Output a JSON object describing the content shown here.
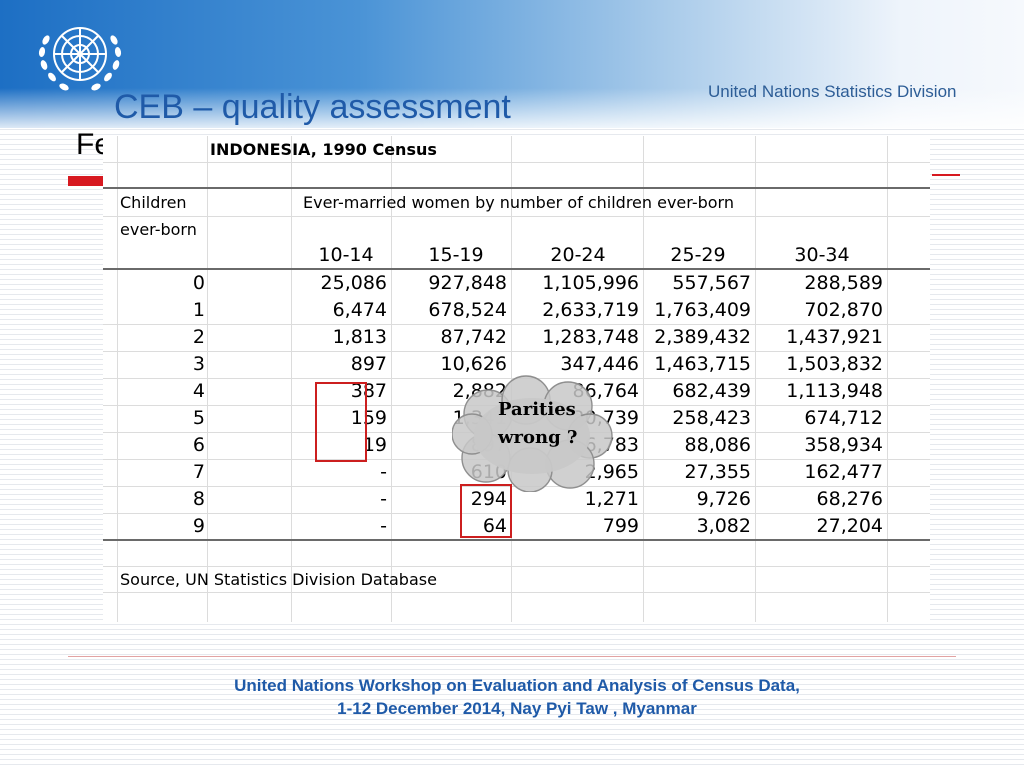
{
  "header": {
    "division": "United Nations Statistics Division",
    "title": "CEB – quality assessment",
    "subtitle_visible_part": "Fe"
  },
  "table": {
    "title": "INDONESIA, 1990 Census",
    "row_header_line1": "Children",
    "row_header_line2": "ever-born",
    "column_group_header": "Ever-married women by number of children ever-born",
    "age_groups": [
      "10-14",
      "15-19",
      "20-24",
      "25-29",
      "30-34"
    ],
    "rows": [
      {
        "children": "0",
        "values": [
          "25,086",
          "927,848",
          "1,105,996",
          "557,567",
          "288,589"
        ]
      },
      {
        "children": "1",
        "values": [
          "6,474",
          "678,524",
          "2,633,719",
          "1,763,409",
          "702,870"
        ]
      },
      {
        "children": "2",
        "values": [
          "1,813",
          "87,742",
          "1,283,748",
          "2,389,432",
          "1,437,921"
        ]
      },
      {
        "children": "3",
        "values": [
          "897",
          "10,626",
          "347,446",
          "1,463,715",
          "1,503,832"
        ]
      },
      {
        "children": "4",
        "values": [
          "387",
          "2,882",
          "86,764",
          "682,439",
          "1,113,948"
        ]
      },
      {
        "children": "5",
        "values": [
          "159",
          "1,341",
          "20,739",
          "258,423",
          "674,712"
        ]
      },
      {
        "children": "6",
        "values": [
          "19",
          "897",
          "6,783",
          "88,086",
          "358,934"
        ]
      },
      {
        "children": "7",
        "values": [
          "-",
          "610",
          "2,965",
          "27,355",
          "162,477"
        ]
      },
      {
        "children": "8",
        "values": [
          "-",
          "294",
          "1,271",
          "9,726",
          "68,276"
        ]
      },
      {
        "children": "9",
        "values": [
          "-",
          "64",
          "799",
          "3,082",
          "27,204"
        ]
      }
    ],
    "source": "Source, UN Statistics Division Database"
  },
  "callout": {
    "line1": "Parities",
    "line2": "wrong ?"
  },
  "footer": {
    "line1": "United Nations Workshop on  Evaluation and Analysis of Census Data,",
    "line2": "1-12 December 2014,  Nay Pyi Taw , Myanmar"
  },
  "colors": {
    "title_blue": "#1f5aa8",
    "highlight_red": "#cc1f1f",
    "accent_red": "#d71920",
    "header_blue": "#1d6fc4"
  }
}
